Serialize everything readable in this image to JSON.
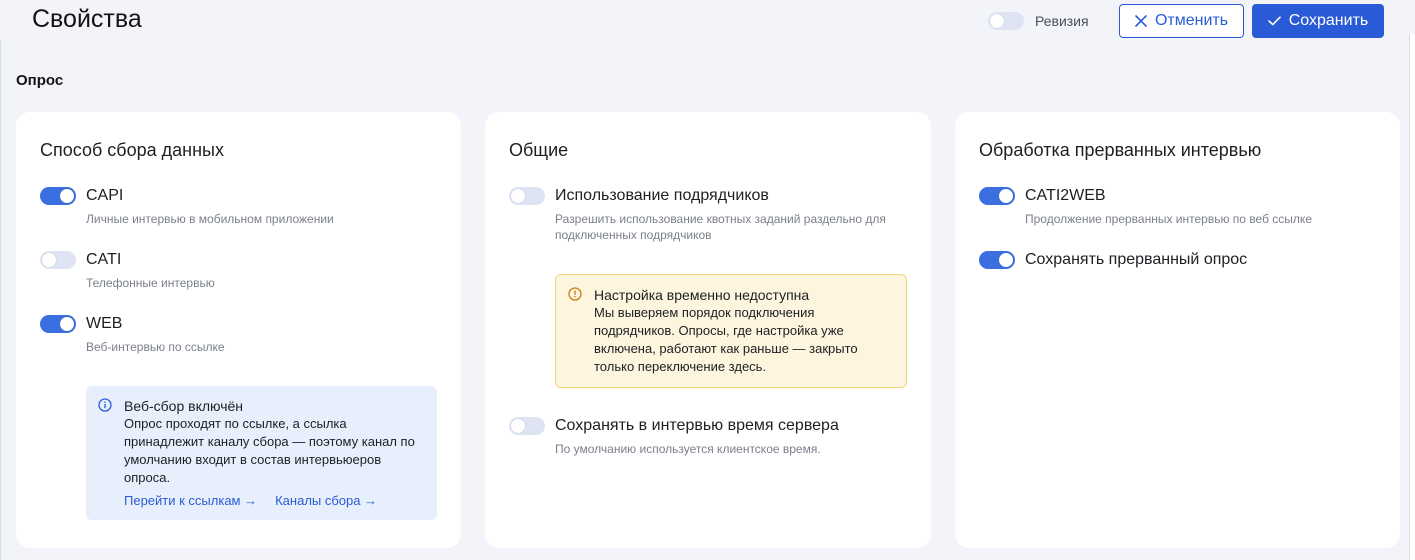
{
  "header": {
    "title": "Свойства",
    "revision_label": "Ревизия",
    "revision_on": false,
    "cancel_label": "Отменить",
    "save_label": "Сохранить"
  },
  "section_title": "Опрос",
  "cards": {
    "collection": {
      "title": "Способ сбора данных",
      "options": [
        {
          "label": "CAPI",
          "description": "Личные интервью в мобильном приложении",
          "on": true
        },
        {
          "label": "CATI",
          "description": "Телефонные интервью",
          "on": false
        },
        {
          "label": "WEB",
          "description": "Веб-интервью по ссылке",
          "on": true
        }
      ],
      "info": {
        "title": "Веб-сбор включён",
        "text": "Опрос проходят по ссылке, а ссылка принадлежит каналу сбора — поэтому канал по умолчанию входит в состав интервьюеров опроса.",
        "link_1": "Перейти к ссылкам →",
        "link_2": "Каналы сбора →"
      }
    },
    "general": {
      "title": "Общие",
      "options": [
        {
          "label": "Использование подрядчиков",
          "description": "Разрешить использование квотных заданий раздельно для подключенных подрядчиков",
          "on": false
        },
        {
          "label": "Сохранять в интервью время сервера",
          "description": "По умолчанию используется клиентское время.",
          "on": false
        }
      ],
      "warning": {
        "title": "Настройка временно недоступна",
        "text": "Мы выверяем порядок подключения подрядчиков. Опросы, где настройка уже включена, работают как раньше — закрыто только переключение здесь."
      }
    },
    "interrupted": {
      "title": "Обработка прерванных интервью",
      "options": [
        {
          "label": "CATI2WEB",
          "description": "Продолжение прерванных интервью по веб ссылке",
          "on": true
        },
        {
          "label": "Сохранять прерванный опрос",
          "description": "",
          "on": true
        }
      ]
    }
  },
  "colors": {
    "accent": "#2a5bd7",
    "toggle_on": "#3b6fdf",
    "toggle_off": "#dfe4f5",
    "info_bg": "#e8effc",
    "warning_bg": "#fdf5de",
    "warning_border": "#f1d27b",
    "page_bg": "#f2f4fa"
  }
}
